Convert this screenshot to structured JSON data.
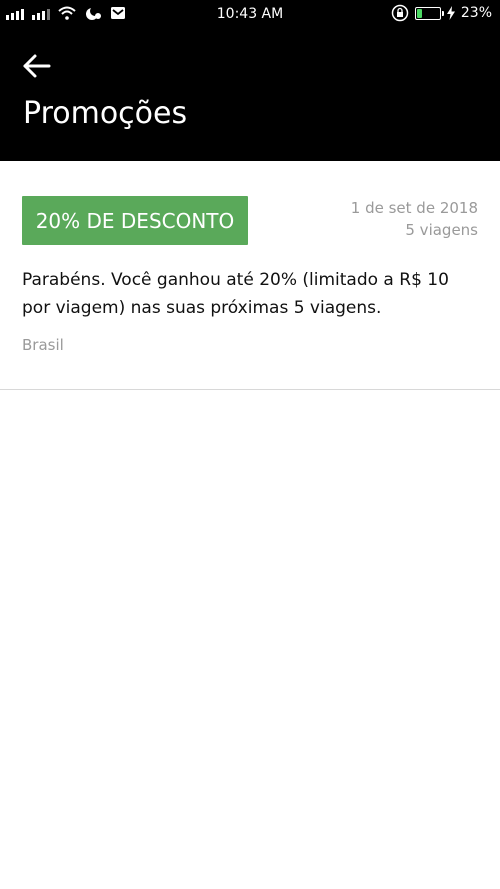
{
  "status_bar": {
    "time": "10:43 AM",
    "battery_percent": "23%",
    "battery_level": 0.23,
    "icons": [
      "signal-bars-icon",
      "signal-bars-icon",
      "wifi-icon",
      "do-not-disturb-icon",
      "mail-icon",
      "rotation-lock-icon",
      "battery-icon",
      "charging-bolt-icon"
    ]
  },
  "header": {
    "title": "Promoções",
    "back_icon": "arrow-left-icon"
  },
  "promotion": {
    "badge": "20% DE DESCONTO",
    "date": "1 de set de 2018",
    "trips": "5 viagens",
    "description": "Parabéns. Você ganhou até 20% (limitado a R$ 10 por viagem) nas suas próximas 5 viagens.",
    "region": "Brasil",
    "badge_color": "#5aa95a"
  }
}
